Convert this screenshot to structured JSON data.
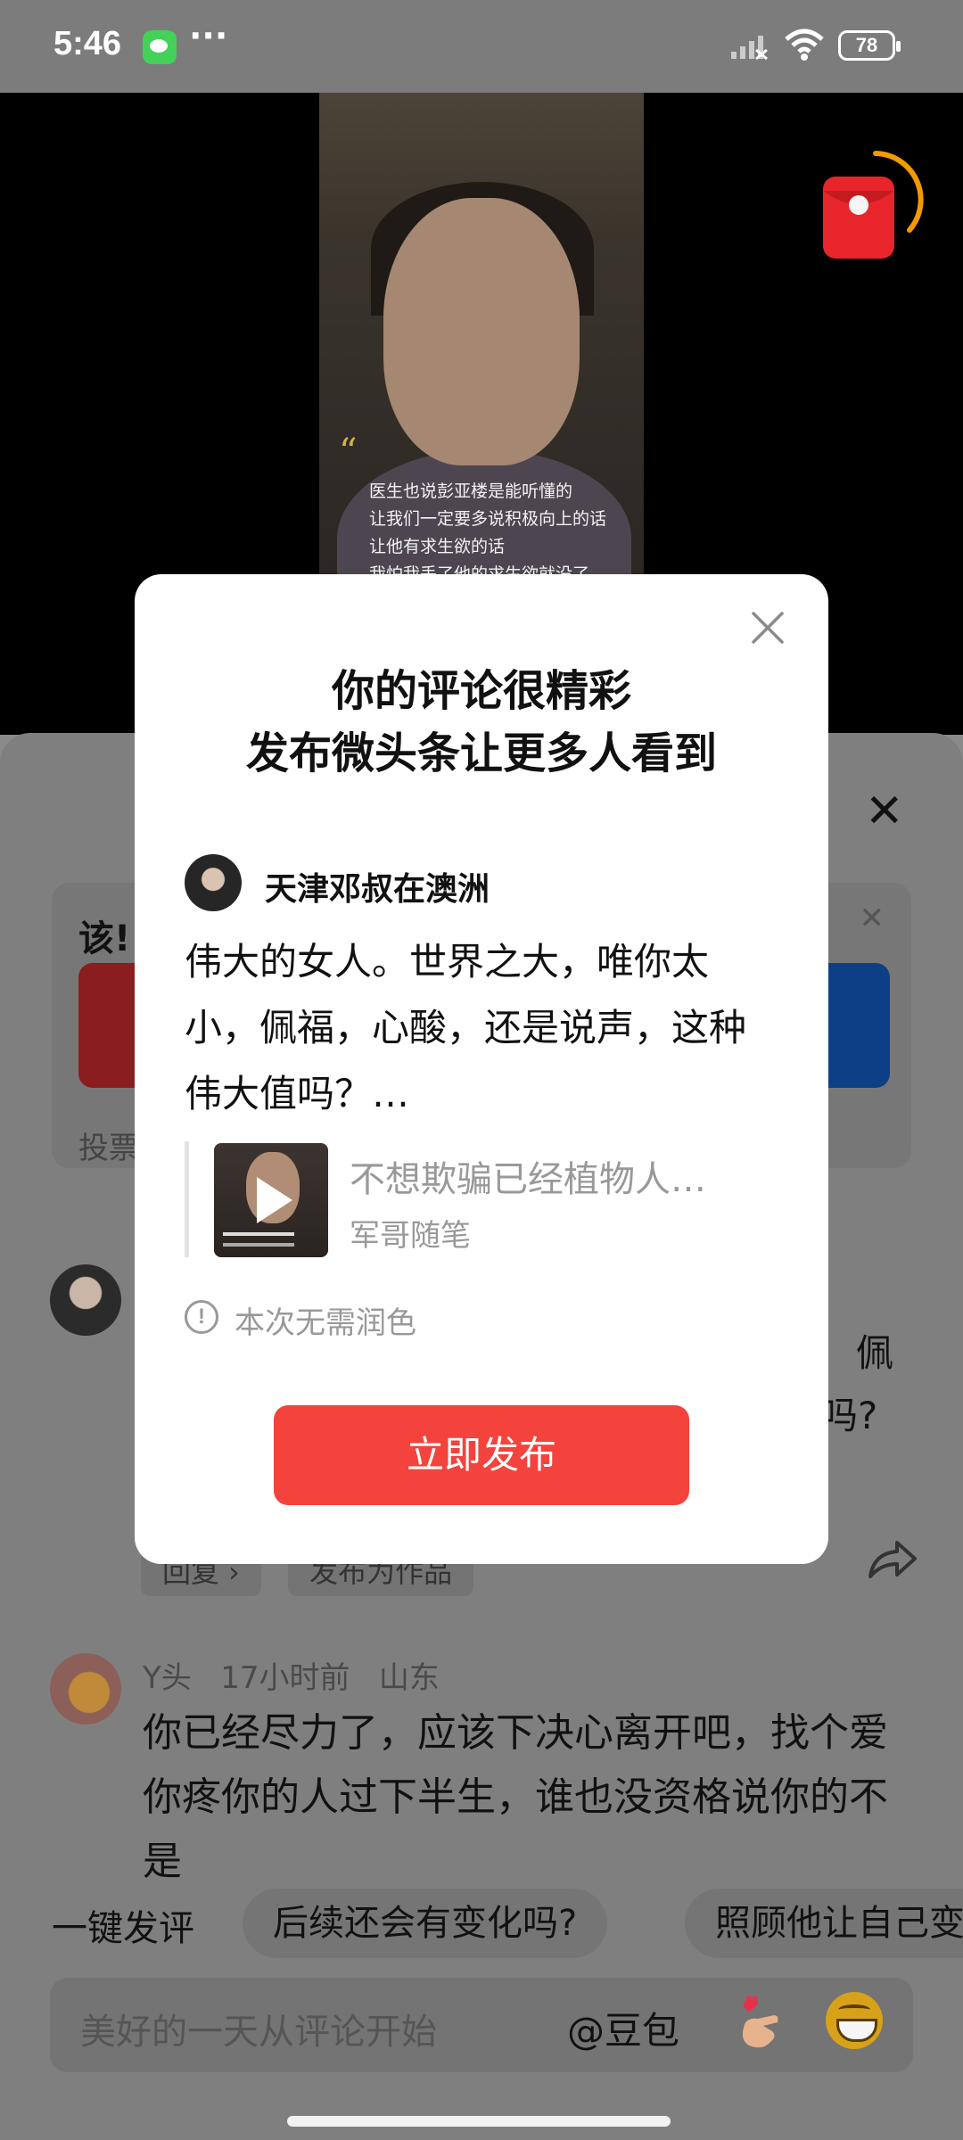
{
  "status_bar": {
    "time": "5:46",
    "dots": "···",
    "battery": "78"
  },
  "video": {
    "quote_mark": "“",
    "caption_lines": [
      "医生也说彭亚楼是能听懂的",
      "让我们一定要多说积极向上的话",
      "让他有求生欲的话",
      "我怕我丢了他的求生欲就没了"
    ],
    "redpacket_icon": "red-envelope-icon"
  },
  "background_panel": {
    "close_glyph": "✕",
    "vote": {
      "title_partial": "该!",
      "footer_partial": "投票",
      "close_glyph": "✕",
      "left_color": "#8a1d1d",
      "right_color": "#0c3f85"
    },
    "comment1": {
      "tail_line1": "佩",
      "tail_line2": "吗?",
      "tags": [
        "回复 ›",
        "发布为作品"
      ]
    },
    "comment2": {
      "user": "Y头",
      "time": "17小时前",
      "location": "山东",
      "text": "你已经尽力了，应该下决心离开吧，找个爱你疼你的人过下半生，谁也没资格说你的不是"
    },
    "quick_reply": {
      "label": "一键发评",
      "chips": [
        "后续还会有变化吗?",
        "照顾他让自己变"
      ]
    },
    "input": {
      "placeholder": "美好的一天从评论开始",
      "mention": "@豆包"
    }
  },
  "modal": {
    "title_line1": "你的评论很精彩",
    "title_line2": "发布微头条让更多人看到",
    "username": "天津邓叔在澳洲",
    "comment": "伟大的女人。世界之大，唯你太小，佩福，心酸，还是说声，这种伟大值吗？…",
    "quoted_title": "不想欺骗已经植物人…",
    "quoted_author": "军哥随笔",
    "notice_icon": "!",
    "notice": "本次无需润色",
    "publish_label": "立即发布",
    "accent_color": "#f3433c"
  }
}
